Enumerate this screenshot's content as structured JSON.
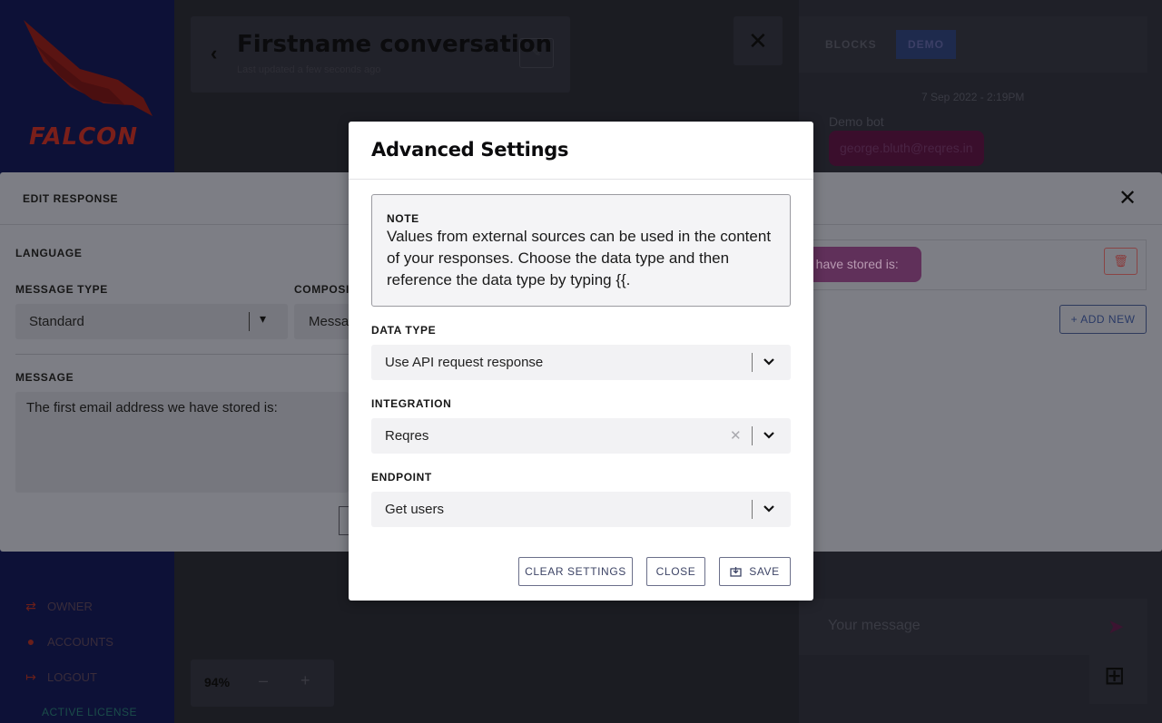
{
  "brand": {
    "logo_text": "FALCON"
  },
  "sidebar": {
    "items": [
      {
        "label": "OWNER",
        "icon": "swap-icon"
      },
      {
        "label": "ACCOUNTS",
        "icon": "user-icon"
      },
      {
        "label": "LOGOUT",
        "icon": "logout-icon"
      }
    ],
    "license": "ACTIVE LICENSE"
  },
  "header": {
    "title": "Firstname conversation",
    "subtitle": "Last updated a few seconds ago"
  },
  "zoom": {
    "value": "94%",
    "minus": "–",
    "plus": "+"
  },
  "right_panel": {
    "tabs": [
      "BLOCKS",
      "DEMO"
    ],
    "active_tab": "DEMO",
    "demo_date": "7 Sep 2022 - 2:19PM",
    "demo_sender": "Demo bot",
    "demo_bubble": "george.bluth@reqres.in",
    "message_placeholder": "Your message"
  },
  "edit_response": {
    "title": "EDIT RESPONSE",
    "language_label": "LANGUAGE",
    "message_type_label": "MESSAGE TYPE",
    "message_type_value": "Standard",
    "compose_label": "COMPOSI",
    "compose_value": "Messa",
    "message_label": "MESSAGE",
    "message_text": "The first email address we have stored is:",
    "bubble_preview": "e have stored is:",
    "add_new": "+ ADD NEW"
  },
  "modal": {
    "title": "Advanced Settings",
    "note_label": "NOTE",
    "note_text": "Values from external sources can be used in the content of your responses. Choose the data type and then reference the data type by typing {{.",
    "data_type_label": "DATA TYPE",
    "data_type_value": "Use API request response",
    "integration_label": "INTEGRATION",
    "integration_value": "Reqres",
    "endpoint_label": "ENDPOINT",
    "endpoint_value": "Get users",
    "clear_settings_label": "CLEAR SETTINGS",
    "close_label": "CLOSE",
    "save_label": "SAVE"
  },
  "colors": {
    "accent": "#3d4466",
    "sidebar_bg": "#0d1137",
    "bubble": "#7a1f5e"
  }
}
